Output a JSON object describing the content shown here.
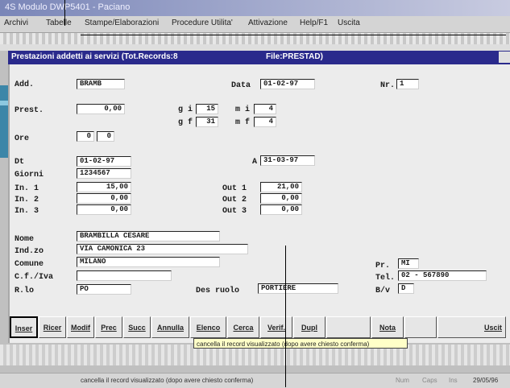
{
  "window": {
    "title": "4S Modulo DWP5401 - Paciano"
  },
  "menu": [
    "Archivi",
    "Tabelle",
    "Stampe/Elaborazioni",
    "Procedure Utilita'",
    "Attivazione",
    "Help/F1",
    "Uscita"
  ],
  "form": {
    "title": "Prestazioni addetti ai servizi (Tot.Records:8",
    "file_label": "File:PRESTAD)",
    "add_label": "Add.",
    "add_value": "BRAMB",
    "data_label": "Data",
    "data_value": "01-02-97",
    "nr_label": "Nr.",
    "nr_value": "1",
    "prest_label": "Prest.",
    "prest_value": "0,00",
    "g1_label": "g i",
    "g1_value": "15",
    "g2_label": "g f",
    "g2_value": "31",
    "m1_label": "m i",
    "m1_value": "4",
    "m2_label": "m f",
    "m2_value": "4",
    "ore_label": "Ore",
    "ore_value": "0",
    "dt_label": "Dt",
    "dt_value": "01-02-97",
    "a_label": "A",
    "a_value": "31-03-97",
    "giorni_label": "Giorni",
    "giorni_value": "1234567",
    "in1_label": "In. 1",
    "in1_value": "15,00",
    "in2_label": "In. 2",
    "in2_value": "0,00",
    "in3_label": "In. 3",
    "in3_value": "0,00",
    "out1_label": "Out 1",
    "out1_value": "21,00",
    "out2_label": "Out 2",
    "out2_value": "0,00",
    "out3_label": "Out 3",
    "out3_value": "0,00",
    "nome_label": "Nome",
    "nome_value": "BRAMBILLA CESARE",
    "ind_label": "Ind.zo",
    "ind_value": "VIA CAMONICA 23",
    "comune_label": "Comune",
    "comune_value": "MILANO",
    "cf_label": "C.f./Iva",
    "cf_value": "",
    "rlo_label": "R.lo",
    "rlo_value": "PO",
    "desruolo_label": "Des ruolo",
    "desruolo_value": "PORTIERE",
    "pr_label": "Pr.",
    "pr_value": "MI",
    "tel_label": "Tel.",
    "tel_value": "02 - 567890",
    "bv_label": "B/v",
    "bv_value": "D"
  },
  "buttons": [
    "Inser",
    "Ricer",
    "Modif",
    "Prec",
    "Succ",
    "Annulla",
    "Elenco",
    "Cerca",
    "Verif.",
    "Dupl",
    "",
    "Nota",
    "",
    "Uscit"
  ],
  "tooltip": "cancella il record visualizzato (dopo avere chiesto conferma)",
  "status": {
    "message": "cancella il record visualizzato (dopo avere chiesto conferma)",
    "num": "Num",
    "caps": "Caps",
    "ins": "Ins",
    "date": "29/05/96"
  }
}
